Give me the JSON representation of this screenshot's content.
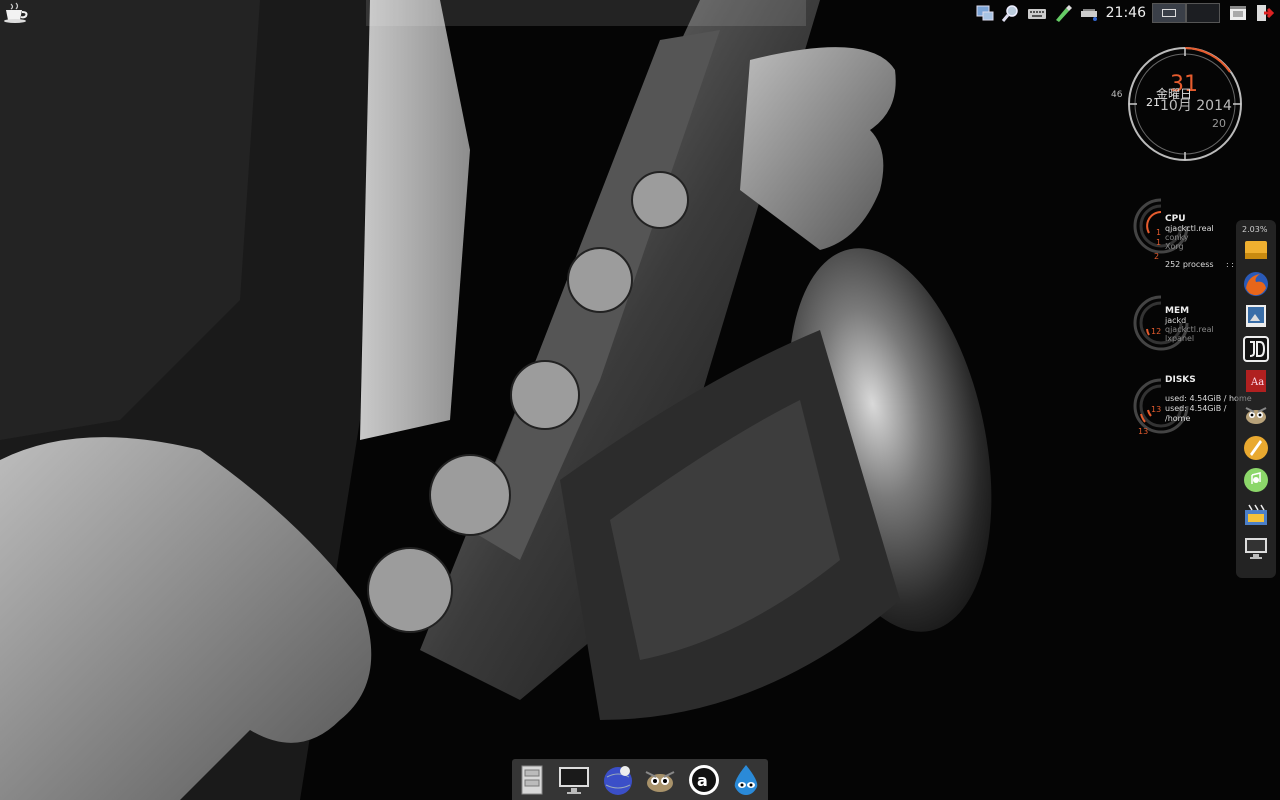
{
  "top_panel": {
    "clock": "21:46",
    "menu_icon": "coffee-cup-icon",
    "tray_icons": [
      "network-icon",
      "magnifier-icon",
      "keyboard-icon",
      "pen-icon",
      "usb-drive-icon"
    ],
    "desktop_pager": [
      "desktop-1",
      "desktop-2"
    ],
    "right_icons": [
      "window-list-icon",
      "logout-icon"
    ]
  },
  "conky_clock": {
    "weekday": "金曜日",
    "day": "31",
    "month_year": "10月 2014",
    "hour": "21",
    "minute": "20",
    "second": "46"
  },
  "conky_stats": {
    "cpu": {
      "title": "CPU",
      "processes": [
        "qjackctl.real",
        "conky",
        "Xorg"
      ],
      "ring_values": [
        "1",
        "1",
        "2"
      ],
      "summary": "252 process",
      "separator": ": :"
    },
    "mem": {
      "title": "MEM",
      "processes": [
        "jackd",
        "qjackctl.real",
        "lxpanel"
      ],
      "ring_value": "12"
    },
    "disks": {
      "title": "DISKS",
      "lines": [
        "used: 4.54GiB / home",
        "used: 4.54GiB /",
        "/home"
      ],
      "ring_values": [
        "13",
        "13"
      ]
    }
  },
  "right_dock": {
    "percent": "2.03%",
    "icons": [
      "drive-icon",
      "firefox-icon",
      "image-viewer-icon",
      "jd-icon",
      "dictionary-icon",
      "gimp-icon",
      "inkscape-icon",
      "music-player-icon",
      "video-editor-icon",
      "monitor-icon"
    ]
  },
  "bottom_dock": {
    "icons": [
      "file-cabinet-icon",
      "monitor-icon",
      "globe-icon",
      "gimp-icon",
      "ardour-icon",
      "dropbox-drop-icon"
    ]
  },
  "colors": {
    "accent": "#e65c2e",
    "panel_text": "#eeeeee"
  }
}
